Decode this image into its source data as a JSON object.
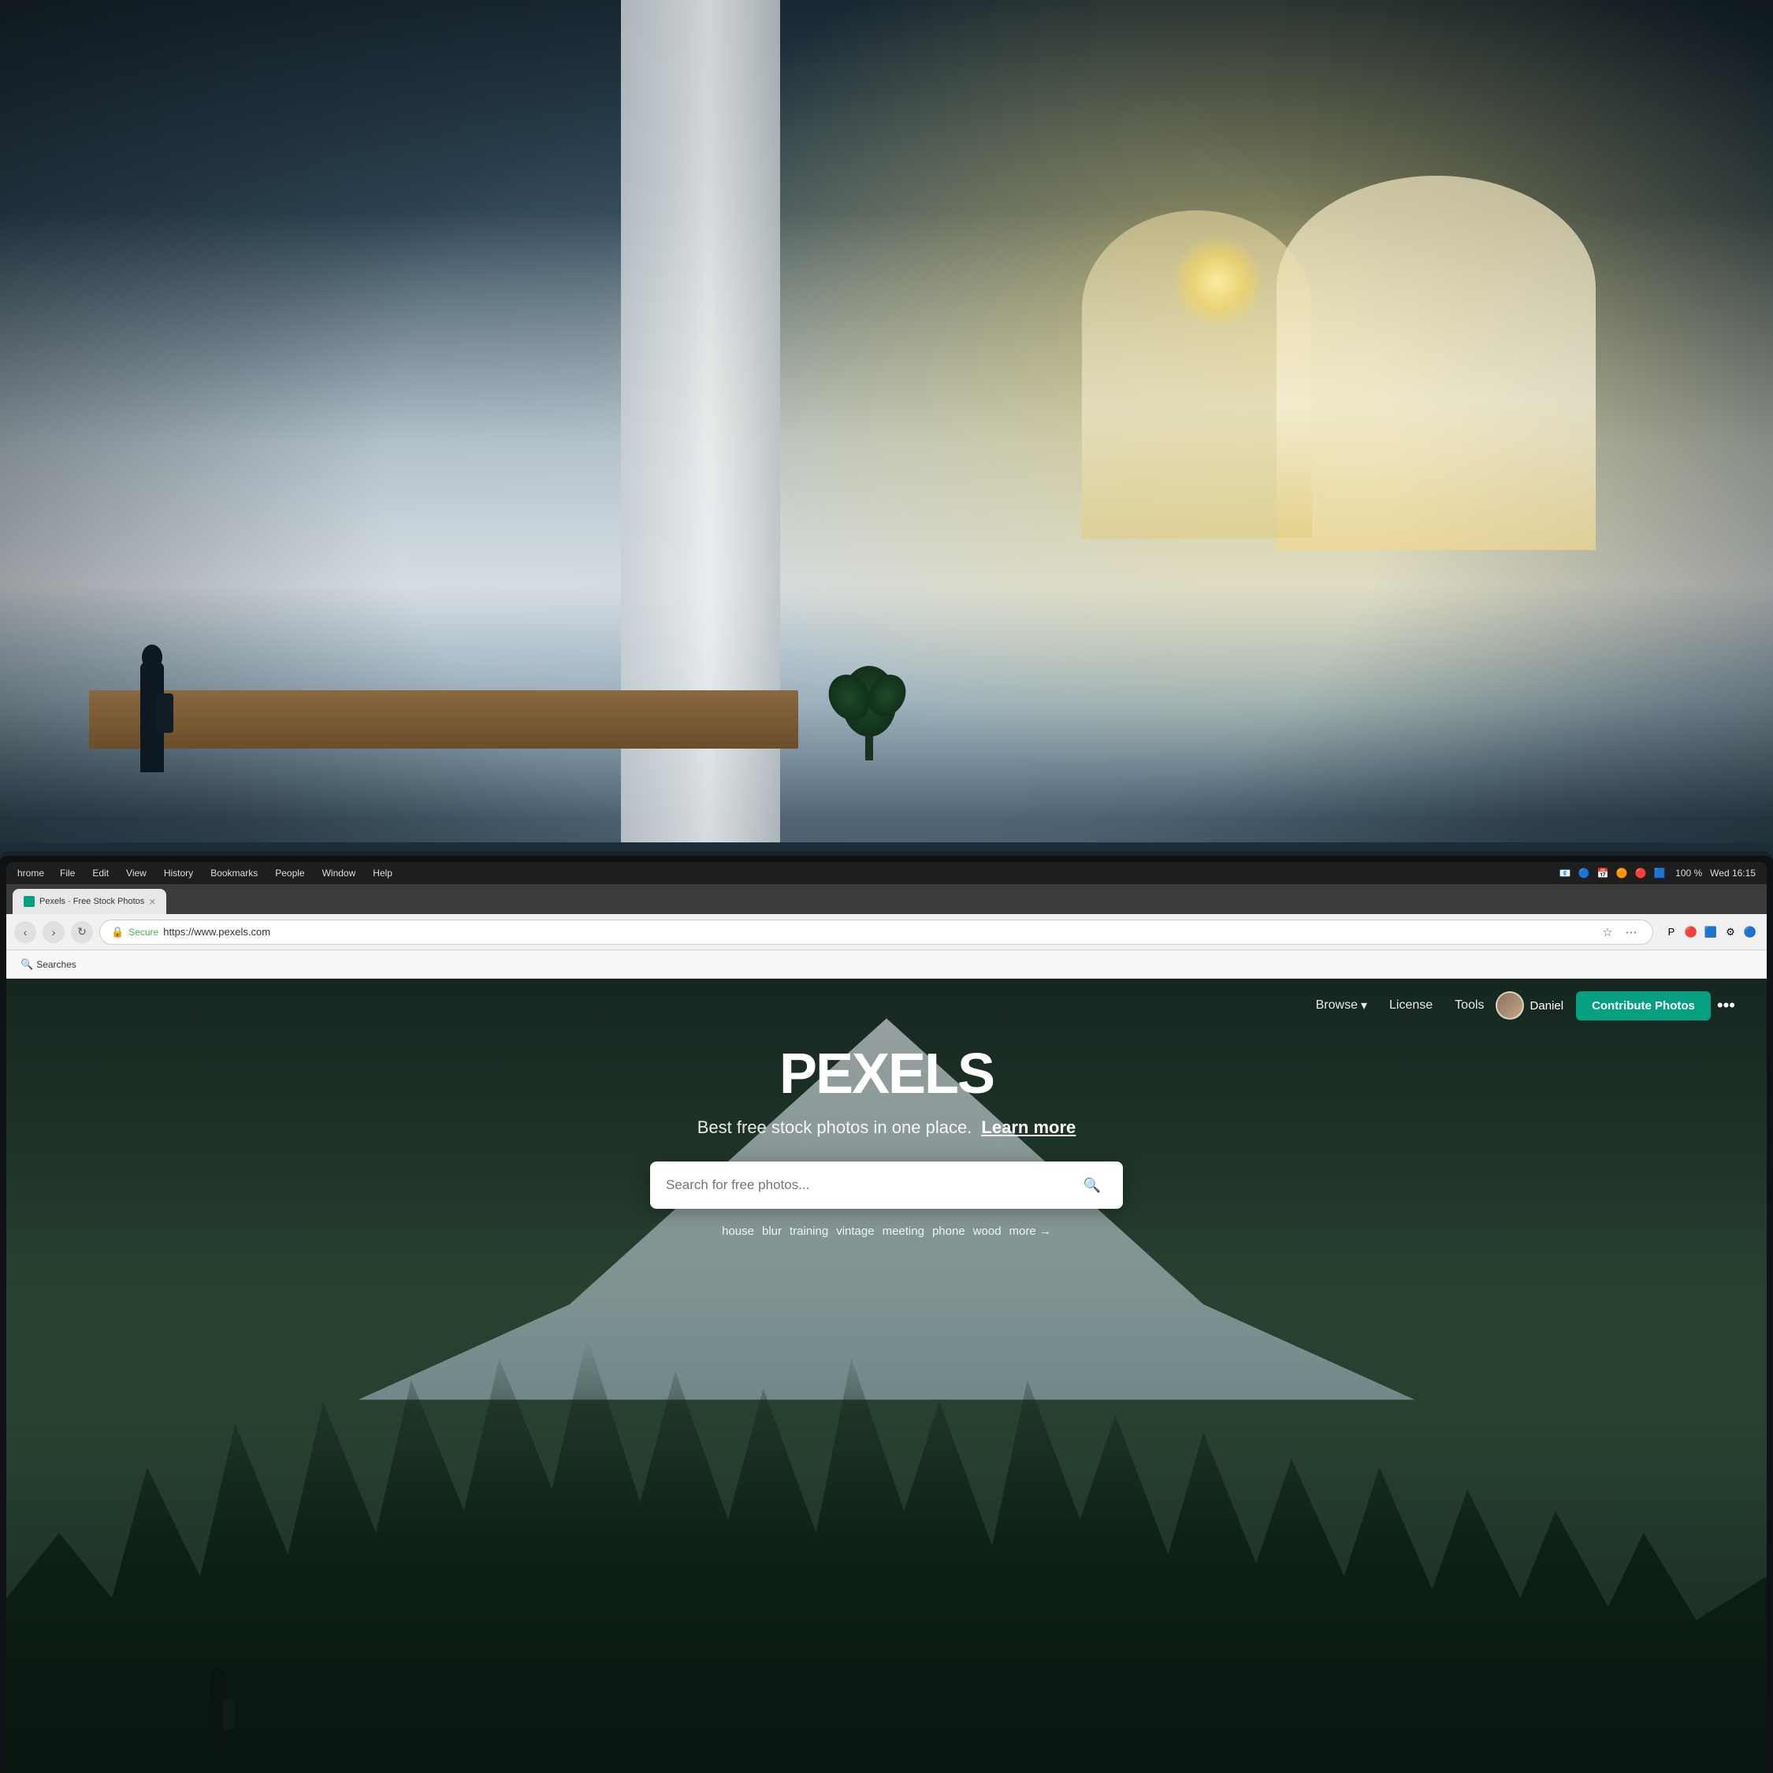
{
  "photo_bg": {
    "alt": "Office interior background photo"
  },
  "sys_toolbar": {
    "app_name": "hrome",
    "menus": [
      "File",
      "Edit",
      "View",
      "History",
      "Bookmarks",
      "People",
      "Window",
      "Help"
    ],
    "time": "Wed 16:15",
    "battery": "100 %"
  },
  "browser": {
    "tab": {
      "label": "Pexels · Free Stock Photos",
      "favicon_color": "#05a081"
    },
    "close_icon": "×",
    "address": {
      "secure_label": "Secure",
      "url": "https://www.pexels.com"
    },
    "bookmarks": [
      {
        "label": "Searches",
        "icon": "🔍"
      }
    ]
  },
  "pexels": {
    "logo": "PEXELS",
    "nav": {
      "browse_label": "Browse",
      "browse_icon": "▾",
      "license_label": "License",
      "tools_label": "Tools",
      "user_name": "Daniel",
      "contribute_label": "Contribute Photos",
      "more_icon": "•••"
    },
    "hero": {
      "headline": "PEXELS",
      "subheadline": "Best free stock photos in one place.",
      "learn_more": "Learn more"
    },
    "search": {
      "placeholder": "Search for free photos...",
      "icon": "🔍"
    },
    "quick_tags": [
      {
        "label": "house"
      },
      {
        "label": "blur"
      },
      {
        "label": "training"
      },
      {
        "label": "vintage"
      },
      {
        "label": "meeting"
      },
      {
        "label": "phone"
      },
      {
        "label": "wood"
      },
      {
        "label": "more →"
      }
    ]
  }
}
